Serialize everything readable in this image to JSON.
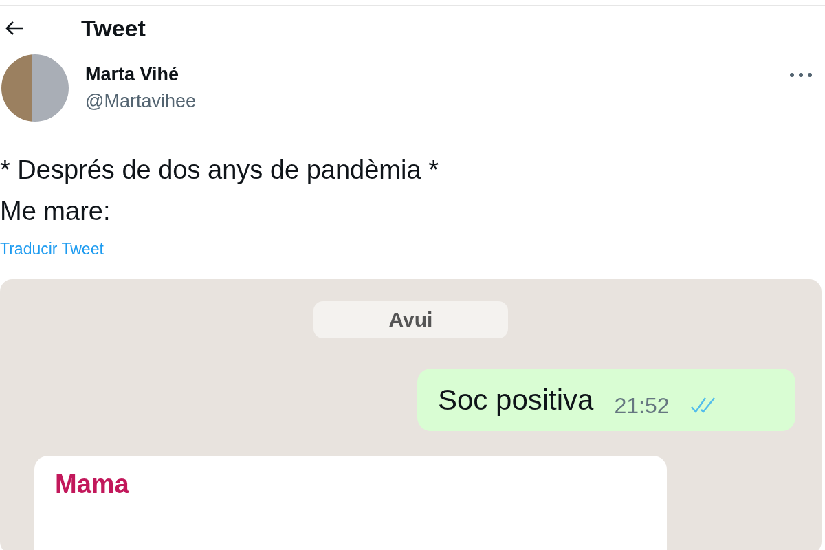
{
  "header": {
    "title": "Tweet"
  },
  "author": {
    "name": "Marta Vihé",
    "handle": "@Martavihee"
  },
  "tweet": {
    "lines": [
      "* Després de dos anys de pandèmia *",
      "Me mare:"
    ],
    "translate_link": "Traducir Tweet"
  },
  "chat": {
    "date": "Avui",
    "messages": [
      {
        "kind": "outgoing",
        "text": "Soc positiva",
        "time": "21:52"
      },
      {
        "kind": "incoming",
        "sender": "Mama"
      }
    ]
  }
}
